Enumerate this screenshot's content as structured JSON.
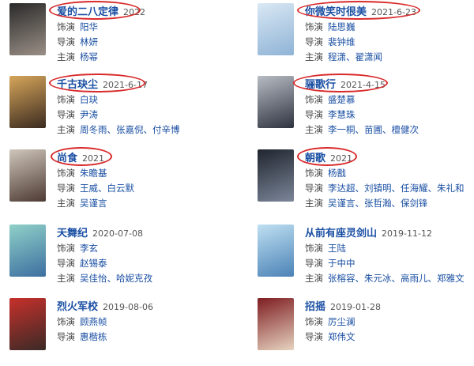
{
  "labels": {
    "role": "饰演",
    "director": "导演",
    "cast": "主演"
  },
  "accent_color": "#1a4fa3",
  "highlight_color": "#d9292a",
  "items": [
    {
      "title": "爱的二八定律",
      "date": "2022",
      "role": "阳华",
      "director": "林妍",
      "cast": "杨幂",
      "poster_colors": [
        "#2a2a2a",
        "#9a8f86"
      ]
    },
    {
      "title": "你微笑时很美",
      "date": "2021-6-23",
      "role": "陆思巍",
      "director": "裴钟维",
      "cast": "程潇、翟潇闻",
      "poster_colors": [
        "#d9e8f4",
        "#8fb3d6"
      ]
    },
    {
      "title": "千古玦尘",
      "date": "2021-6-17",
      "role": "白玦",
      "director": "尹涛",
      "cast": "周冬雨、张嘉倪、付辛博",
      "poster_colors": [
        "#d6a55a",
        "#3b2b20"
      ]
    },
    {
      "title": "骊歌行",
      "date": "2021-4-15",
      "role": "盛楚慕",
      "director": "李慧珠",
      "cast": "李一桐、苗圃、檀健次",
      "poster_colors": [
        "#b8bcc4",
        "#2e3340"
      ]
    },
    {
      "title": "尚食",
      "date": "2021",
      "role": "朱瞻基",
      "director": "王威、白云默",
      "cast": "吴谨言",
      "poster_colors": [
        "#cfc6bb",
        "#4d3a33"
      ]
    },
    {
      "title": "朝歌",
      "date": "2021",
      "role": "杨戬",
      "director": "李达超、刘镇明、任海耀、朱礼和",
      "cast": "吴谨言、张哲瀚、保剑锋",
      "poster_colors": [
        "#20252e",
        "#7b8699"
      ]
    },
    {
      "title": "天舞纪",
      "date": "2020-07-08",
      "role": "李玄",
      "director": "赵锡泰",
      "cast": "吴佳怡、哈妮克孜",
      "poster_colors": [
        "#8fd0c8",
        "#3d6fa0"
      ]
    },
    {
      "title": "从前有座灵剑山",
      "date": "2019-11-12",
      "role": "王陆",
      "director": "于中中",
      "cast": "张榕容、朱元冰、高雨儿、郑雅文",
      "poster_colors": [
        "#bfe0f2",
        "#4b82b6"
      ]
    },
    {
      "title": "烈火军校",
      "date": "2019-08-06",
      "role": "顾燕帧",
      "director": "惠楷栋",
      "cast": "",
      "poster_colors": [
        "#c7302b",
        "#3a2a26"
      ]
    },
    {
      "title": "招摇",
      "date": "2019-01-28",
      "role": "厉尘澜",
      "director": "郑伟文",
      "cast": "",
      "poster_colors": [
        "#7e1d21",
        "#e6d3c0"
      ]
    }
  ]
}
